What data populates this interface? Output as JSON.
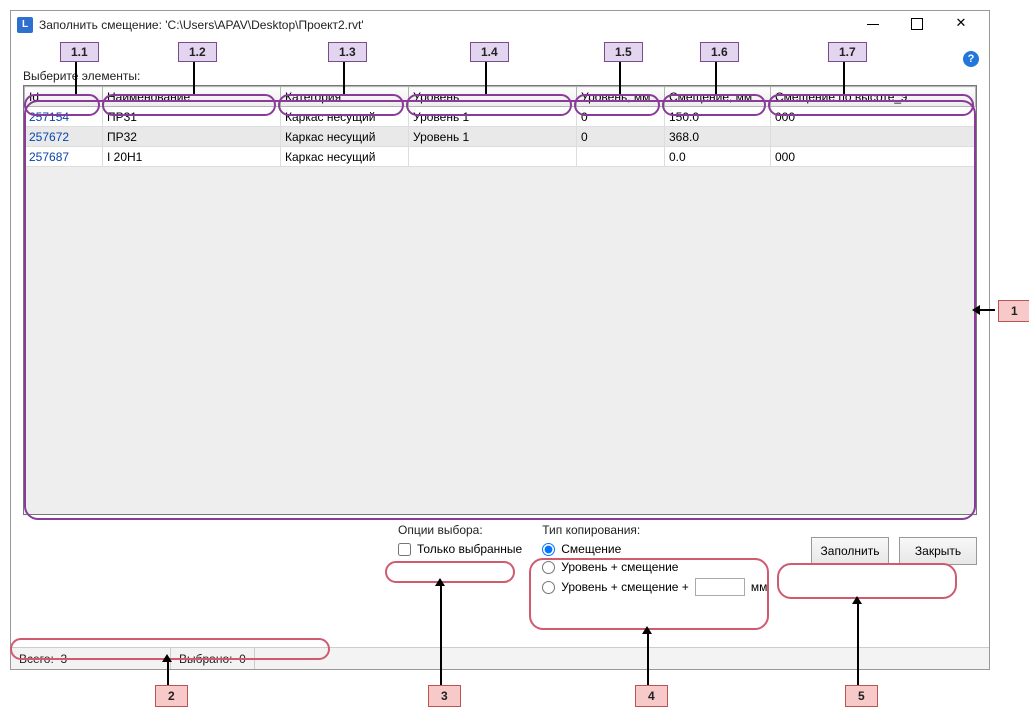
{
  "window": {
    "app_icon_letter": "L",
    "title": "Заполнить смещение: 'C:\\Users\\APAV\\Desktop\\Проект2.rvt'"
  },
  "labels": {
    "choose_elements": "Выберите элементы:",
    "options_title": "Опции выбора:",
    "only_selected": "Только выбранные",
    "copy_type_title": "Тип копирования:",
    "r_offset": "Смещение",
    "r_level_offset": "Уровень + смещение",
    "r_level_offset_plus": "Уровень + смещение +",
    "mm_suffix": "мм",
    "btn_fill": "Заполнить",
    "btn_close": "Закрыть"
  },
  "columns": {
    "id": "Id",
    "name": "Наименование",
    "category": "Категория",
    "level": "Уровень",
    "level_mm": "Уровень, мм",
    "offset_mm": "Смещение, мм",
    "height_offset": "Смещение по высоте_э"
  },
  "rows": [
    {
      "id": "257154",
      "name": "ПР31",
      "category": "Каркас несущий",
      "level": "Уровень 1",
      "level_mm": "0",
      "offset_mm": "150.0",
      "height_offset": "000"
    },
    {
      "id": "257672",
      "name": "ПР32",
      "category": "Каркас несущий",
      "level": "Уровень 1",
      "level_mm": "0",
      "offset_mm": "368.0",
      "height_offset": ""
    },
    {
      "id": "257687",
      "name": "I 20Н1",
      "category": "Каркас несущий",
      "level": "",
      "level_mm": "",
      "offset_mm": "0.0",
      "height_offset": "000"
    }
  ],
  "status": {
    "total_label": "Всего:",
    "total": "3",
    "selected_label": "Выбрано:",
    "selected": "0"
  },
  "radio_state": {
    "checked": "offset"
  },
  "checkbox_state": {
    "only_selected": false
  },
  "annotations": {
    "t1": "1",
    "t11": "1.1",
    "t12": "1.2",
    "t13": "1.3",
    "t14": "1.4",
    "t15": "1.5",
    "t16": "1.6",
    "t17": "1.7",
    "t2": "2",
    "t3": "3",
    "t4": "4",
    "t5": "5"
  }
}
